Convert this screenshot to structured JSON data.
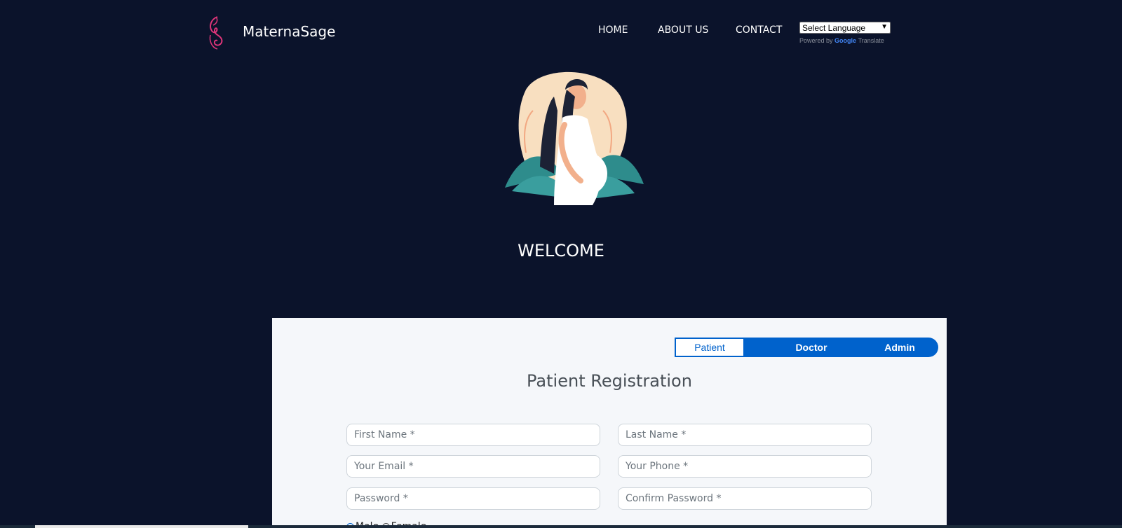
{
  "header": {
    "brand": "MaternaSage",
    "nav": [
      {
        "label": "HOME"
      },
      {
        "label": "ABOUT US"
      },
      {
        "label": "CONTACT"
      }
    ],
    "language_select": "Select Language",
    "powered_by": "Powered by",
    "google": "Google",
    "translate": "Translate"
  },
  "hero": {
    "welcome": "WELCOME"
  },
  "registration": {
    "tabs": [
      {
        "label": "Patient",
        "active": true
      },
      {
        "label": "Doctor",
        "active": false
      },
      {
        "label": "Admin",
        "active": false
      }
    ],
    "title": "Patient Registration",
    "fields": {
      "first_name": "First Name *",
      "last_name": "Last Name *",
      "email": "Your Email *",
      "phone": "Your Phone *",
      "password": "Password *",
      "confirm_password": "Confirm Password *"
    },
    "gender": {
      "male": "Male",
      "female": "Female",
      "selected": "Male"
    }
  },
  "colors": {
    "background": "#0b132b",
    "accent": "#0062cc",
    "logo": "#e0357a"
  }
}
